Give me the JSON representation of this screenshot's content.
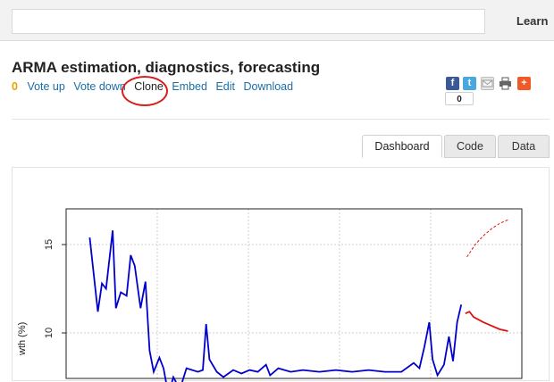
{
  "header": {
    "search_placeholder": "",
    "learn_label": "Learn"
  },
  "page": {
    "title": "ARMA estimation, diagnostics, forecasting",
    "votes": "0",
    "actions": {
      "vote_up": "Vote up",
      "vote_down": "Vote down",
      "clone": "Clone",
      "embed": "Embed",
      "edit": "Edit",
      "download": "Download"
    },
    "share": {
      "count": "0",
      "icons": [
        "facebook-icon",
        "twitter-icon",
        "email-icon",
        "print-icon",
        "addthis-icon"
      ],
      "colors": {
        "facebook": "#3b5998",
        "twitter": "#4aa8de",
        "addthis": "#f05a28"
      }
    }
  },
  "tabs": [
    "Dashboard",
    "Code",
    "Data"
  ],
  "active_tab": "Dashboard",
  "chart_data": {
    "type": "line",
    "ylabel": "wth (%)",
    "y_ticks": [
      15,
      10
    ],
    "ylim": [
      0,
      17.0
    ],
    "xlim": [
      0,
      50
    ],
    "grid": true,
    "series": [
      {
        "color": "#0000cc",
        "style": "solid",
        "points": [
          [
            2,
            15.4
          ],
          [
            3.0,
            11.2
          ],
          [
            3.5,
            12.8
          ],
          [
            4.0,
            12.5
          ],
          [
            4.8,
            15.8
          ],
          [
            5.2,
            11.4
          ],
          [
            5.8,
            12.3
          ],
          [
            6.5,
            12.1
          ],
          [
            7.0,
            14.4
          ],
          [
            7.5,
            13.8
          ],
          [
            8.2,
            11.4
          ],
          [
            8.8,
            12.9
          ],
          [
            9.3,
            9.0
          ],
          [
            9.8,
            7.8
          ],
          [
            10.5,
            8.6
          ],
          [
            11.0,
            8.0
          ],
          [
            11.6,
            6.5
          ],
          [
            12.2,
            7.5
          ],
          [
            13.0,
            6.8
          ],
          [
            13.8,
            8.0
          ],
          [
            15.2,
            7.8
          ],
          [
            15.8,
            7.9
          ],
          [
            16.2,
            10.5
          ],
          [
            16.6,
            8.5
          ],
          [
            17.5,
            7.8
          ],
          [
            18.3,
            7.5
          ],
          [
            19.5,
            7.9
          ],
          [
            20.5,
            7.7
          ],
          [
            21.5,
            7.9
          ],
          [
            22.5,
            7.8
          ],
          [
            23.5,
            8.2
          ],
          [
            24.0,
            7.6
          ],
          [
            25.0,
            8.0
          ],
          [
            26.5,
            7.8
          ],
          [
            28.0,
            7.9
          ],
          [
            30.0,
            7.8
          ],
          [
            32.0,
            7.9
          ],
          [
            34.0,
            7.8
          ],
          [
            36.0,
            7.9
          ],
          [
            38.0,
            7.8
          ],
          [
            40.0,
            7.8
          ],
          [
            41.5,
            8.3
          ],
          [
            42.2,
            8.0
          ],
          [
            42.8,
            9.2
          ],
          [
            43.4,
            10.6
          ],
          [
            43.8,
            8.5
          ],
          [
            44.4,
            7.6
          ],
          [
            45.2,
            8.2
          ],
          [
            45.8,
            9.8
          ],
          [
            46.3,
            8.4
          ],
          [
            46.8,
            10.6
          ],
          [
            47.3,
            11.6
          ]
        ]
      },
      {
        "color": "#dd1111",
        "style": "solid",
        "points": [
          [
            47.8,
            11.1
          ],
          [
            48.3,
            11.2
          ],
          [
            48.8,
            10.9
          ],
          [
            50.0,
            10.6
          ],
          [
            51.0,
            10.4
          ],
          [
            52.0,
            10.2
          ],
          [
            53.0,
            10.1
          ]
        ]
      },
      {
        "color": "#dd1111",
        "style": "dashed",
        "points": [
          [
            48.0,
            14.3
          ],
          [
            49.0,
            15.0
          ],
          [
            50.0,
            15.5
          ],
          [
            51.0,
            15.9
          ],
          [
            52.0,
            16.2
          ],
          [
            53.0,
            16.4
          ]
        ]
      }
    ]
  }
}
